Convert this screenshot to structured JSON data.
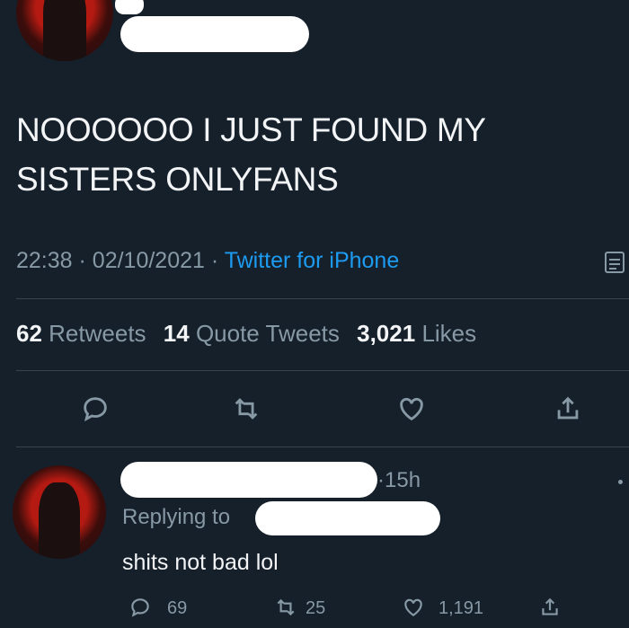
{
  "tweet": {
    "text_line1": "NOOOOOO I JUST FOUND MY",
    "text_line2": "SISTERS ONLYFANS",
    "time": "22:38",
    "date": "02/10/2021",
    "source": "Twitter for iPhone",
    "dot": "·"
  },
  "stats": {
    "retweets_count": "62",
    "retweets_label": "Retweets",
    "quotes_count": "14",
    "quotes_label": "Quote Tweets",
    "likes_count": "3,021",
    "likes_label": "Likes"
  },
  "reply": {
    "time": "15h",
    "replying_to": "Replying to",
    "text": "shits not bad lol",
    "reply_count": "69",
    "retweet_count": "25",
    "like_count": "1,191"
  },
  "icons": [
    "reply-icon",
    "retweet-icon",
    "like-icon",
    "share-icon",
    "analytics-icon"
  ],
  "colors": {
    "background": "#15202b",
    "link": "#1d9bf0",
    "muted": "#8899a6",
    "text": "#f2f4f6"
  }
}
